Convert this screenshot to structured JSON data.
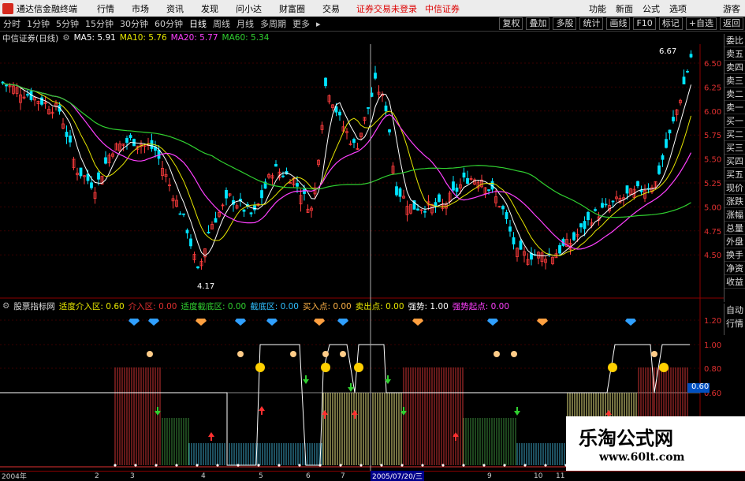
{
  "menubar": {
    "app": "通达信金融终端",
    "items": [
      "行情",
      "市场",
      "资讯",
      "发现",
      "问小达",
      "财富圈",
      "交易"
    ],
    "warning": "证券交易未登录",
    "warning2": "中信证券",
    "right": [
      "功能",
      "新面",
      "公式",
      "选项"
    ],
    "user": "游客"
  },
  "toolbar": {
    "periods": [
      "分时",
      "1分钟",
      "5分钟",
      "15分钟",
      "30分钟",
      "60分钟",
      "日线",
      "周线",
      "月线",
      "多周期",
      "更多"
    ],
    "selected": "日线",
    "right": [
      "复权",
      "叠加",
      "多股",
      "统计",
      "画线",
      "F10",
      "标记",
      "+自选",
      "返回"
    ]
  },
  "main": {
    "title": "中信证券(日线)",
    "ma5": "MA5: 5.91",
    "ma10": "MA10: 5.76",
    "ma20": "MA20: 5.77",
    "ma60": "MA60: 5.34",
    "hi_label": "6.67",
    "lo_label": "4.17"
  },
  "yaxis": [
    "6.50",
    "6.25",
    "6.00",
    "5.75",
    "5.50",
    "5.25",
    "5.00",
    "4.75",
    "4.50"
  ],
  "indicator": {
    "name": "股票指标网",
    "items": [
      {
        "label": "适度介入区: 0.60",
        "color": "#e6e600"
      },
      {
        "label": "介入区: 0.00",
        "color": "#e03030"
      },
      {
        "label": "适度截底区: 0.00",
        "color": "#30d030"
      },
      {
        "label": "截底区: 0.00",
        "color": "#30c0ff"
      },
      {
        "label": "买入点: 0.00",
        "color": "#ffb347"
      },
      {
        "label": "卖出点: 0.00",
        "color": "#e6e600"
      },
      {
        "label": "强势: 1.00",
        "color": "#ffffff"
      },
      {
        "label": "强势起点: 0.00",
        "color": "#ff40ff"
      }
    ],
    "yaxis": [
      "1.20",
      "1.00",
      "0.80",
      "0.60",
      "0.00"
    ],
    "current": "0.60"
  },
  "rightpanel": [
    "委比",
    "卖五",
    "卖四",
    "卖三",
    "卖二",
    "卖一",
    "买一",
    "买二",
    "买三",
    "买四",
    "买五",
    "现价",
    "涨跌",
    "涨幅",
    "总量",
    "外盘",
    "换手",
    "净资",
    "收益"
  ],
  "rightpanel2": [
    "自动",
    "行情"
  ],
  "xaxis": [
    "2004年",
    "2",
    "3",
    "4",
    "5",
    "6",
    "7",
    "2005/07/20/三",
    "9",
    "10",
    "11"
  ],
  "watermark": {
    "title": "乐淘公式网",
    "url": "www.60lt.com"
  },
  "colors": {
    "up": "#ff3c3c",
    "down": "#00e5ff",
    "ma5": "#ffffff",
    "ma10": "#e6e600",
    "ma20": "#ff40ff",
    "ma60": "#30d030"
  }
}
